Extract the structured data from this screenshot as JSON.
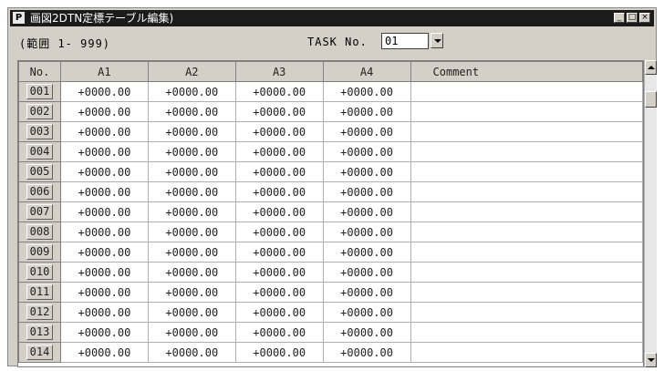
{
  "window": {
    "app_icon": "P",
    "title": "画図2DTN定標テーブル編集)",
    "controls": {
      "minimize": "_",
      "maximize": "□",
      "close": "×"
    }
  },
  "range_label": "(範囲 1- 999)",
  "task": {
    "label": "TASK No.",
    "value": "01"
  },
  "table": {
    "headers": [
      "No.",
      "A1",
      "A2",
      "A3",
      "A4",
      "Comment"
    ],
    "rows": [
      {
        "no": "001",
        "a1": "+0000.00",
        "a2": "+0000.00",
        "a3": "+0000.00",
        "a4": "+0000.00",
        "comment": ""
      },
      {
        "no": "002",
        "a1": "+0000.00",
        "a2": "+0000.00",
        "a3": "+0000.00",
        "a4": "+0000.00",
        "comment": ""
      },
      {
        "no": "003",
        "a1": "+0000.00",
        "a2": "+0000.00",
        "a3": "+0000.00",
        "a4": "+0000.00",
        "comment": ""
      },
      {
        "no": "004",
        "a1": "+0000.00",
        "a2": "+0000.00",
        "a3": "+0000.00",
        "a4": "+0000.00",
        "comment": ""
      },
      {
        "no": "005",
        "a1": "+0000.00",
        "a2": "+0000.00",
        "a3": "+0000.00",
        "a4": "+0000.00",
        "comment": ""
      },
      {
        "no": "006",
        "a1": "+0000.00",
        "a2": "+0000.00",
        "a3": "+0000.00",
        "a4": "+0000.00",
        "comment": ""
      },
      {
        "no": "007",
        "a1": "+0000.00",
        "a2": "+0000.00",
        "a3": "+0000.00",
        "a4": "+0000.00",
        "comment": ""
      },
      {
        "no": "008",
        "a1": "+0000.00",
        "a2": "+0000.00",
        "a3": "+0000.00",
        "a4": "+0000.00",
        "comment": ""
      },
      {
        "no": "009",
        "a1": "+0000.00",
        "a2": "+0000.00",
        "a3": "+0000.00",
        "a4": "+0000.00",
        "comment": ""
      },
      {
        "no": "010",
        "a1": "+0000.00",
        "a2": "+0000.00",
        "a3": "+0000.00",
        "a4": "+0000.00",
        "comment": ""
      },
      {
        "no": "011",
        "a1": "+0000.00",
        "a2": "+0000.00",
        "a3": "+0000.00",
        "a4": "+0000.00",
        "comment": ""
      },
      {
        "no": "012",
        "a1": "+0000.00",
        "a2": "+0000.00",
        "a3": "+0000.00",
        "a4": "+0000.00",
        "comment": ""
      },
      {
        "no": "013",
        "a1": "+0000.00",
        "a2": "+0000.00",
        "a3": "+0000.00",
        "a4": "+0000.00",
        "comment": ""
      },
      {
        "no": "014",
        "a1": "+0000.00",
        "a2": "+0000.00",
        "a3": "+0000.00",
        "a4": "+0000.00",
        "comment": ""
      }
    ]
  }
}
